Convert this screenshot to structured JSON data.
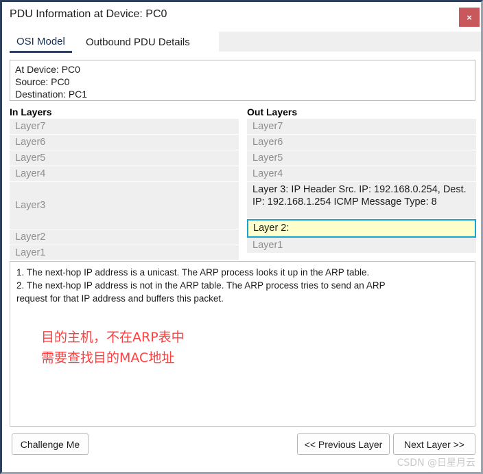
{
  "window": {
    "title": "PDU Information at Device: PC0",
    "close_label": "×",
    "close_icon": "close-icon",
    "accent_color": "#2e3f5c",
    "close_button_color": "#c8585c"
  },
  "tabs": [
    {
      "label": "OSI Model",
      "active": true
    },
    {
      "label": "Outbound PDU Details",
      "active": false
    }
  ],
  "info": {
    "at_device": "At Device: PC0",
    "source": "Source: PC0",
    "destination": "Destination: PC1"
  },
  "in_layers": {
    "header": "In Layers",
    "rows": [
      {
        "text": "Layer7",
        "state": "empty",
        "size": "normal"
      },
      {
        "text": "Layer6",
        "state": "empty",
        "size": "normal"
      },
      {
        "text": "Layer5",
        "state": "empty",
        "size": "normal"
      },
      {
        "text": "Layer4",
        "state": "empty",
        "size": "normal"
      },
      {
        "text": "Layer3",
        "state": "empty",
        "size": "tall"
      },
      {
        "text": "Layer2",
        "state": "empty",
        "size": "normal"
      },
      {
        "text": "Layer1",
        "state": "empty",
        "size": "normal"
      }
    ]
  },
  "out_layers": {
    "header": "Out Layers",
    "rows": [
      {
        "text": "Layer7",
        "state": "empty",
        "size": "normal"
      },
      {
        "text": "Layer6",
        "state": "empty",
        "size": "normal"
      },
      {
        "text": "Layer5",
        "state": "empty",
        "size": "normal"
      },
      {
        "text": "Layer4",
        "state": "empty",
        "size": "normal"
      },
      {
        "text": "Layer 3: IP Header Src. IP: 192.168.0.254, Dest. IP: 192.168.1.254 ICMP Message Type: 8",
        "state": "filled",
        "size": "tall-3"
      },
      {
        "text": "Layer 2:",
        "state": "selected",
        "size": "normal"
      },
      {
        "text": "Layer1",
        "state": "empty",
        "size": "normal"
      }
    ],
    "selected_bg": "#ffffcc",
    "selected_border": "#15a6cf"
  },
  "description": {
    "lines": [
      "1. The next-hop IP address is a unicast. The ARP process looks it up in the ARP table.",
      "2. The next-hop IP address is not in the ARP table. The ARP process tries to send an ARP",
      "request for that IP address and buffers this packet."
    ],
    "annotation_line1": "目的主机，不在ARP表中",
    "annotation_line2": "需要查找目的MAC地址",
    "annotation_color": "#fc3f3f"
  },
  "footer": {
    "challenge_me": "Challenge Me",
    "previous_layer": "<< Previous Layer",
    "next_layer": "Next Layer >>"
  },
  "watermark": "CSDN @日星月云"
}
